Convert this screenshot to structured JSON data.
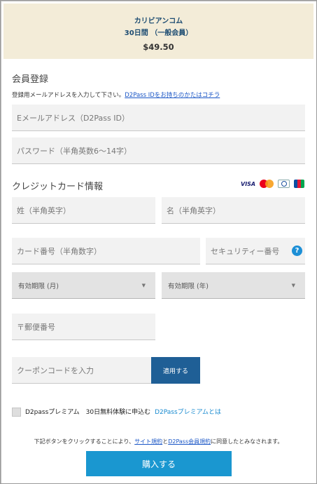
{
  "product": {
    "name": "カリビアンコム",
    "plan": "30日間 （一般会員）",
    "price": "$49.50"
  },
  "registration": {
    "heading": "会員登録",
    "note_text": "登録用メールアドレスを入力して下さい。",
    "note_link": "D2Pass IDをお持ちのかたはコチラ",
    "email_placeholder": "Eメールアドレス（D2Pass ID）",
    "password_placeholder": "パスワード（半角英数6～14字）"
  },
  "credit_card": {
    "heading": "クレジットカード情報",
    "brands": [
      "VISA",
      "Mastercard",
      "Diners Club",
      "JCB"
    ],
    "visa_label": "VISA",
    "last_name_placeholder": "姓（半角英字）",
    "first_name_placeholder": "名（半角英字）",
    "card_number_placeholder": "カード番号（半角数字）",
    "security_code_placeholder": "セキュリティー番号",
    "help_label": "?",
    "expiry_month": "有効期限 (月)",
    "expiry_year": "有効期限 (年)",
    "postal_placeholder": "〒郵便番号"
  },
  "coupon": {
    "placeholder": "クーポンコードを入力",
    "apply_label": "適用する"
  },
  "premium": {
    "label": "D2passプレミアム　30日無料体験に申込む",
    "link": "D2Passプレミアムとは"
  },
  "terms": {
    "prefix": "下記ボタンをクリックすることにより、",
    "link1": "サイト規約",
    "middle": "と",
    "link2": "D2Pass会員規約",
    "suffix": "に同意したとみなされます。"
  },
  "purchase": {
    "label": "購入する"
  },
  "colors": {
    "banner_bg": "#f3ecd8",
    "product_text": "#1d4c72",
    "apply_button": "#1f5f96",
    "buy_button": "#1a97d0",
    "link": "#1a56c6",
    "help_icon": "#1c8fd6"
  }
}
